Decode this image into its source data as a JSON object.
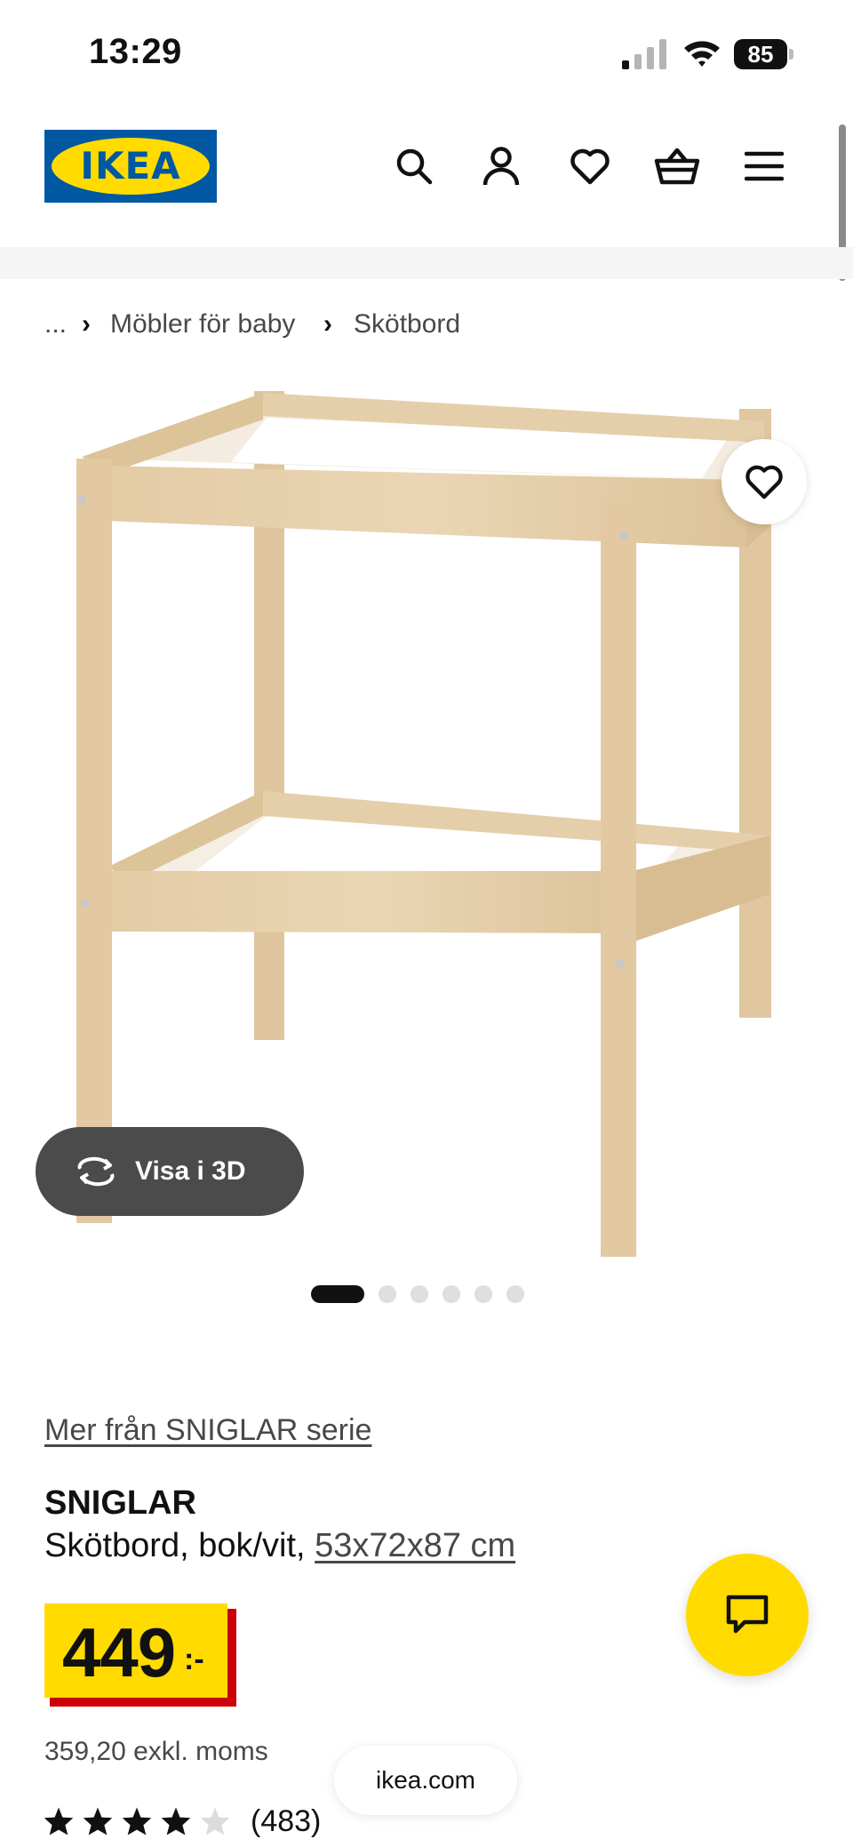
{
  "status_bar": {
    "time": "13:29",
    "battery": "85"
  },
  "header": {
    "logo_text": "IKEA",
    "icons": [
      "search-icon",
      "account-icon",
      "heart-icon",
      "cart-icon",
      "menu-icon"
    ]
  },
  "breadcrumb": {
    "ellipsis": "...",
    "items": [
      "Möbler för baby",
      "Skötbord"
    ]
  },
  "gallery": {
    "view_3d_label": "Visa i 3D",
    "slide_count": 6,
    "active_slide": 1
  },
  "product": {
    "series_link": "Mer från SNIGLAR serie",
    "name": "SNIGLAR",
    "description_prefix": "Skötbord, bok/vit, ",
    "dimensions": "53x72x87 cm",
    "price": "449",
    "price_suffix": ":-",
    "price_ex_vat": "359,20 exkl. moms",
    "rating_stars": 4,
    "review_count": "(483)"
  },
  "browser": {
    "url": "ikea.com"
  },
  "colors": {
    "ikea_yellow": "#ffdb00",
    "ikea_blue": "#0058a3",
    "price_red": "#cc0008"
  }
}
